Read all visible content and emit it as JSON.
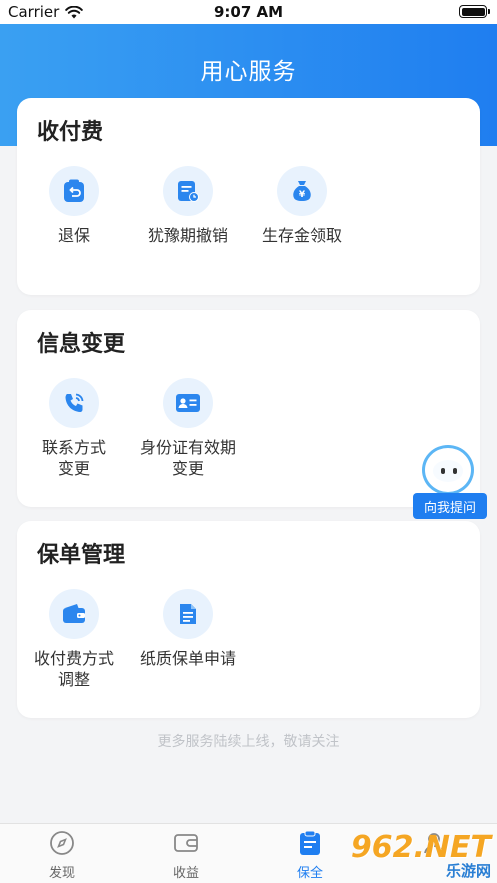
{
  "status_bar": {
    "carrier": "Carrier",
    "time": "9:07 AM"
  },
  "header": {
    "title": "用心服务"
  },
  "sections": [
    {
      "title": "收付费",
      "items": [
        {
          "label": "退保",
          "icon": "return-icon"
        },
        {
          "label": "犹豫期撤销",
          "icon": "document-clock-icon"
        },
        {
          "label": "生存金领取",
          "icon": "money-bag-icon"
        }
      ]
    },
    {
      "title": "信息变更",
      "items": [
        {
          "label": "联系方式\n变更",
          "icon": "phone-icon"
        },
        {
          "label": "身份证有效期\n变更",
          "icon": "id-card-icon"
        }
      ]
    },
    {
      "title": "保单管理",
      "items": [
        {
          "label": "收付费方式\n调整",
          "icon": "wallet-icon"
        },
        {
          "label": "纸质保单申请",
          "icon": "document-icon"
        }
      ]
    }
  ],
  "footer_note": "更多服务陆续上线，敬请关注",
  "assistant": {
    "label": "向我提问"
  },
  "tabbar": {
    "tabs": [
      {
        "label": "发现",
        "icon": "compass-icon"
      },
      {
        "label": "收益",
        "icon": "wallet-outline-icon"
      },
      {
        "label": "保全",
        "icon": "clipboard-icon"
      },
      {
        "label": "",
        "icon": "user-icon"
      }
    ],
    "active": "保全"
  },
  "watermark": {
    "top": "962.NET",
    "bottom": "乐游网"
  },
  "colors": {
    "accent": "#1f7ef0",
    "header_start": "#3aa0f2",
    "icon_bg": "#e8f2fd"
  }
}
